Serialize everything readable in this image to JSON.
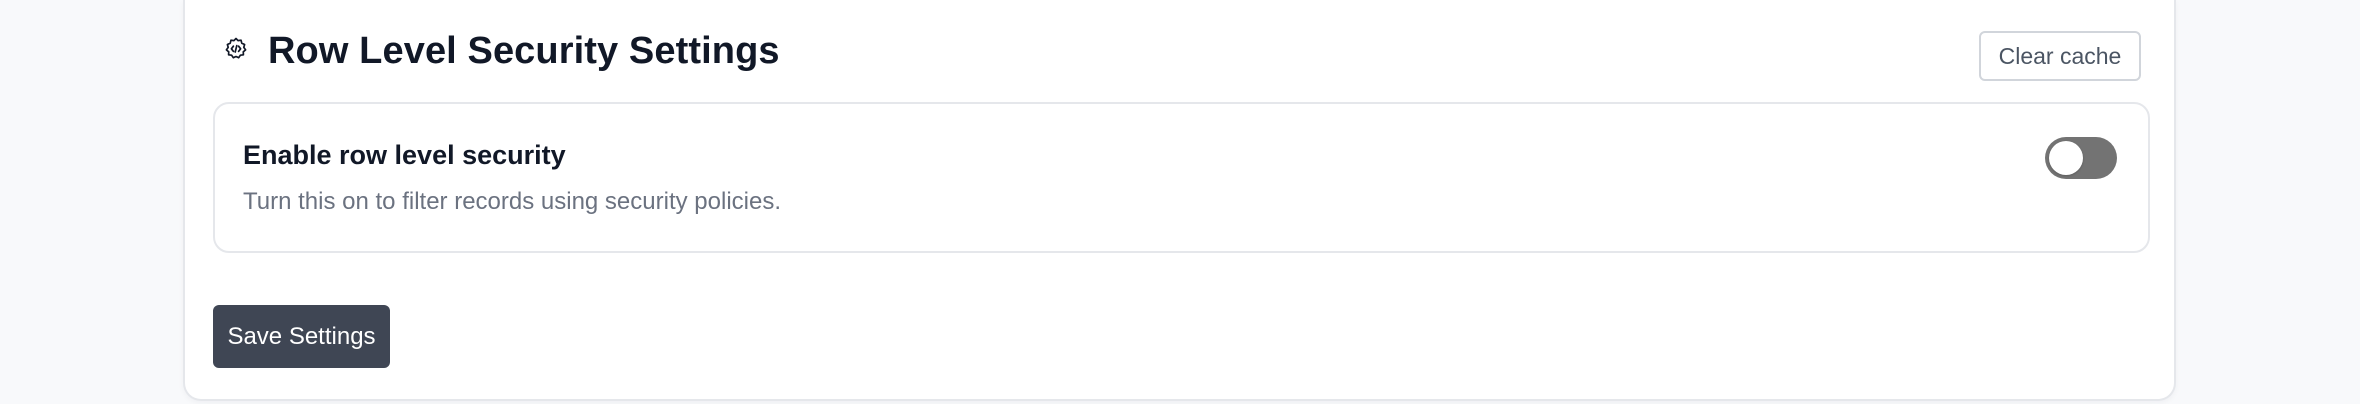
{
  "header": {
    "icon": "code-settings-icon",
    "title": "Row Level Security Settings",
    "clear_cache_label": "Clear cache"
  },
  "setting": {
    "label": "Enable row level security",
    "description": "Turn this on to filter records using security policies.",
    "toggle_enabled": false
  },
  "footer": {
    "save_label": "Save Settings"
  },
  "colors": {
    "toggle_off": "#737373",
    "save_button": "#3f4654",
    "border": "#e5e7eb"
  }
}
